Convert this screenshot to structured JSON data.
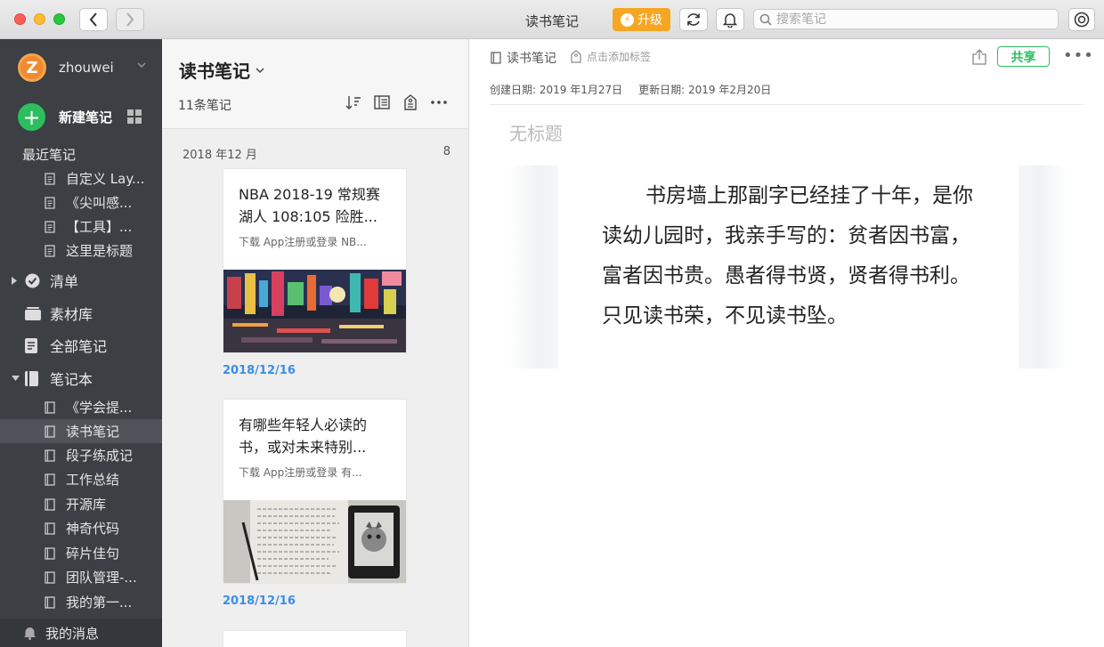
{
  "window": {
    "title": "读书笔记",
    "upgrade_label": "升级",
    "search_placeholder": "搜索笔记"
  },
  "sidebar": {
    "username": "zhouwei",
    "avatar_letter": "Z",
    "new_note": "新建笔记",
    "recent_header": "最近笔记",
    "recent": [
      "自定义 Lay...",
      "《尖叫感...",
      "【工具】...",
      "这里是标题"
    ],
    "checklist": "清单",
    "materials": "素材库",
    "all_notes": "全部笔记",
    "notebooks": "笔记本",
    "notebook_items": [
      "《学会提...",
      "读书笔记",
      "段子练成记",
      "工作总结",
      "开源库",
      "神奇代码",
      "碎片佳句",
      "团队管理-...",
      "我的第一..."
    ],
    "messages": "我的消息"
  },
  "notelist": {
    "title": "读书笔记",
    "count": "11条笔记",
    "month": "2018 年12 月",
    "month_count": "8",
    "cards": [
      {
        "title": "NBA 2018-19 常规赛湖人 108:105 险胜...",
        "snippet": "下载 App注册或登录 NB...",
        "date": "2018/12/16"
      },
      {
        "title": "有哪些年轻人必读的书，或对未来特别...",
        "snippet": "下载 App注册或登录 有...",
        "date": "2018/12/16"
      }
    ]
  },
  "editor": {
    "notebook": "读书笔记",
    "add_tag": "点击添加标签",
    "share": "共享",
    "created": "创建日期: 2019 年1月27日",
    "updated": "更新日期: 2019 年2月20日",
    "title_placeholder": "无标题",
    "body": "书房墙上那副字已经挂了十年，是你读幼儿园时，我亲手写的：贫者因书富，富者因书贵。愚者得书贤，贤者得书利。只见读书荣，不见读书坠。"
  },
  "colors": {
    "brand_green": "#2dbe60",
    "upgrade_orange": "#f6a623",
    "sidebar_bg": "#3c3f43",
    "date_blue": "#3a8ee6"
  },
  "icons": [
    "back-icon",
    "forward-icon",
    "bolt-icon",
    "sync-icon",
    "bell-icon",
    "search-icon",
    "account-icon",
    "sort-icon",
    "view-icon",
    "tag-icon",
    "more-icon",
    "share-icon",
    "notebook-icon",
    "note-icon"
  ]
}
